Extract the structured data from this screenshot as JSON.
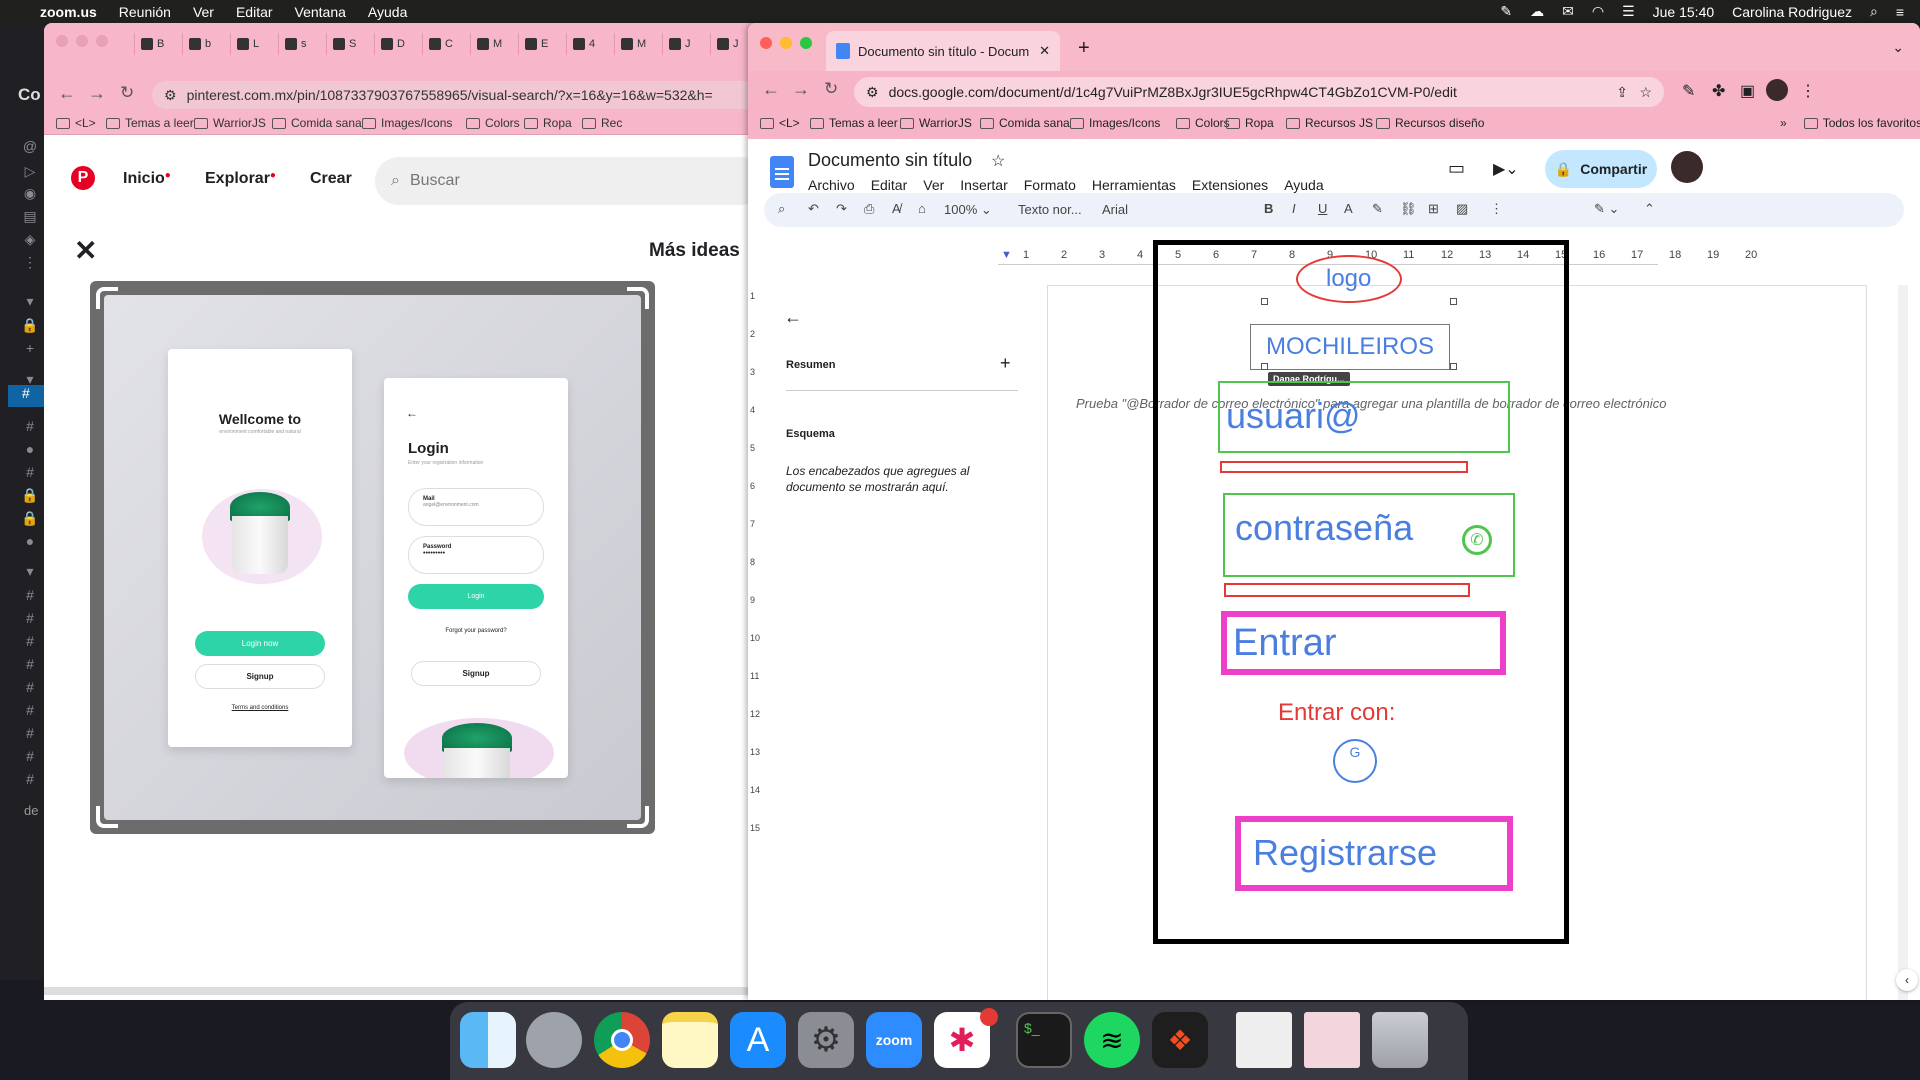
{
  "menubar": {
    "app": "zoom.us",
    "items": [
      "Reunión",
      "Ver",
      "Editar",
      "Ventana",
      "Ayuda"
    ],
    "clock": "Jue 15:40",
    "user": "Carolina Rodriguez"
  },
  "pinterest": {
    "url": "pinterest.com.mx/pin/1087337903767558965/visual-search/?x=16&y=16&w=532&h=",
    "tabs": [
      "B",
      "b",
      "L",
      "s",
      "S",
      "D",
      "C",
      "M",
      "E",
      "4",
      "M",
      "J",
      "J"
    ],
    "bookmarks": [
      "<L>",
      "Temas a leer",
      "WarriorJS",
      "Comida sana",
      "Images/Icons",
      "Colors",
      "Ropa",
      "Rec"
    ],
    "nav": {
      "inicio": "Inicio",
      "explorar": "Explorar",
      "crear": "Crear",
      "search_placeholder": "Buscar"
    },
    "more_ideas": "Más ideas",
    "card1": {
      "title": "Wellcome to",
      "subtitle": "environment comfortable and natural",
      "btn1": "Login now",
      "btn2": "Signup",
      "terms": "Terms and conditions"
    },
    "card2": {
      "title": "Login",
      "subtitle": "Enter your registration information",
      "mail_label": "Mail",
      "mail_value": "angel@environment.com",
      "pass_label": "Password",
      "pass_value": "•••••••••",
      "btn": "Login",
      "forgot": "Forgot your password?",
      "signup": "Signup"
    }
  },
  "docs": {
    "tab_title": "Documento sin título - Docum",
    "url": "docs.google.com/document/d/1c4g7VuiPrMZ8BxJgr3IUE5gcRhpw4CT4GbZo1CVM-P0/edit",
    "bookmarks": [
      "<L>",
      "Temas a leer",
      "WarriorJS",
      "Comida sana",
      "Images/Icons",
      "Colors",
      "Ropa",
      "Recursos JS",
      "Recursos diseño"
    ],
    "all_bookmarks": "Todos los favoritos",
    "title": "Documento sin título",
    "menus": [
      "Archivo",
      "Editar",
      "Ver",
      "Insertar",
      "Formato",
      "Herramientas",
      "Extensiones",
      "Ayuda"
    ],
    "share": "Compartir",
    "zoom": "100%",
    "style": "Texto nor...",
    "font": "Arial",
    "outline": {
      "resumen": "Resumen",
      "esquema": "Esquema",
      "hint": "Los encabezados que agregues al documento se mostrarán aquí."
    },
    "placeholder": "Prueba \"@Borrador de correo electrónico\" para agregar una plantilla de borrador de correo electrónico",
    "ruler": [
      "1",
      "2",
      "3",
      "4",
      "5",
      "6",
      "7",
      "8",
      "9",
      "10",
      "11",
      "12",
      "13",
      "14",
      "15",
      "16",
      "17",
      "18",
      "19",
      "20"
    ],
    "vruler": [
      "1",
      "2",
      "3",
      "4",
      "5",
      "6",
      "7",
      "8",
      "9",
      "10",
      "11",
      "12",
      "13",
      "14",
      "15"
    ],
    "mockup": {
      "logo": "logo",
      "brand": "MOCHILEIROS",
      "user": "usuari@",
      "password": "contraseña",
      "enter": "Entrar",
      "enter_with": "Entrar con:",
      "google": "G",
      "register": "Registrarse",
      "cursor_tag": "Danae Rodrígu..."
    }
  },
  "colors": {
    "pink_tab": "#f7b4c6",
    "docs_blue": "#1a73e8",
    "mint": "#2dd4a7",
    "mock_blue": "#4a7fe0",
    "mock_green": "#4fc54f",
    "mock_red": "#e53935",
    "mock_pink": "#ee3fc9"
  }
}
